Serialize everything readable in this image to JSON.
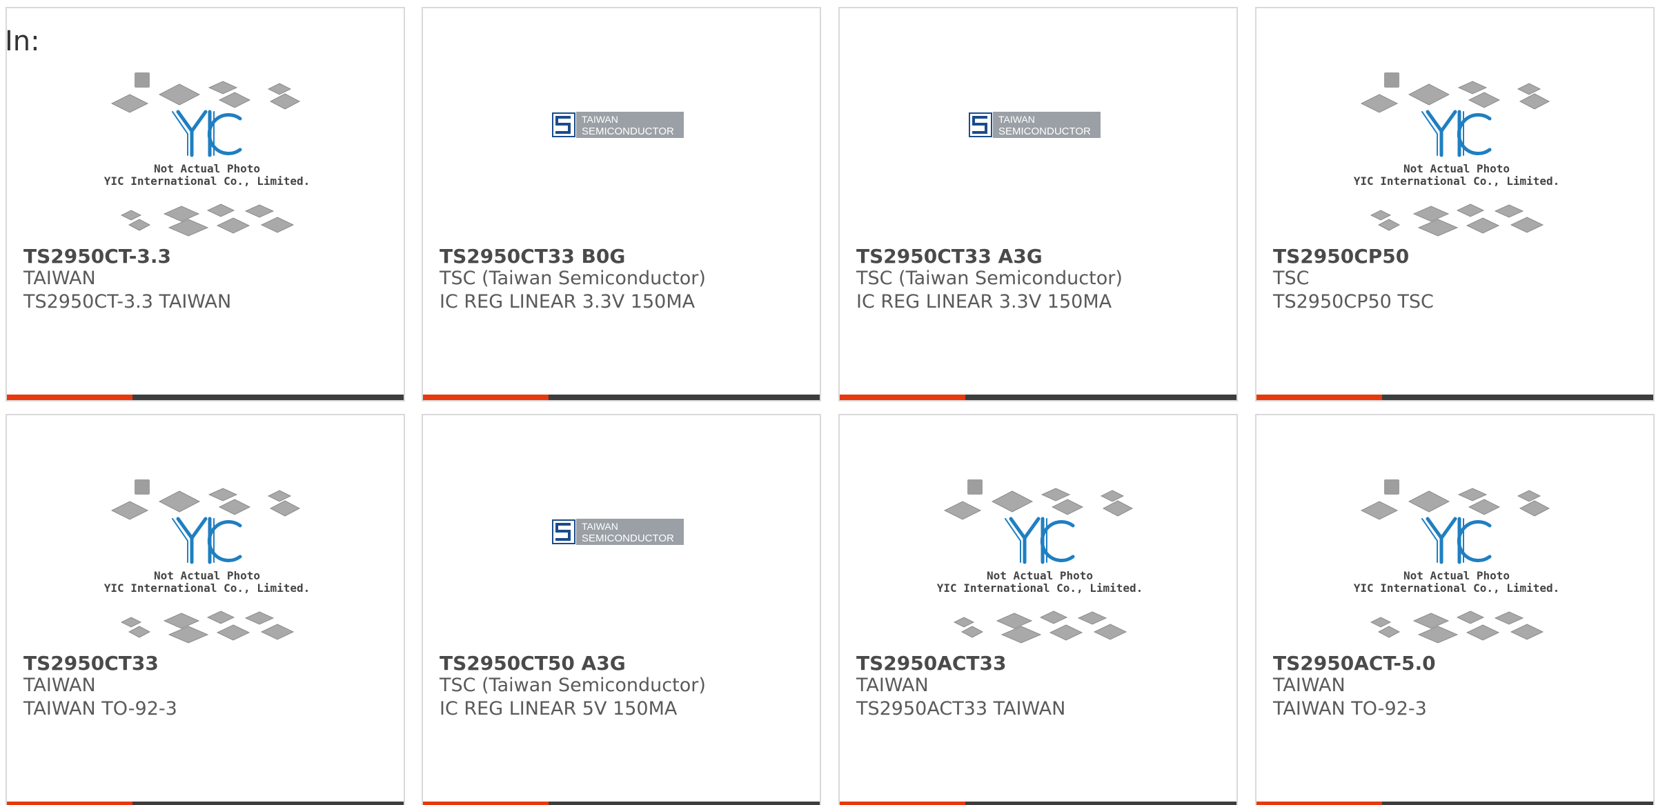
{
  "header": {
    "prefix": "In:"
  },
  "brand_colors": {
    "accent": "#e8380d",
    "bar": "#3d3d3d",
    "yic_blue": "#1f7fc1",
    "tsc_blue": "#1a4c8c",
    "tsc_gray": "#9aa0a6"
  },
  "cards": [
    {
      "part": "TS2950CT-3.3",
      "maker": "TAIWAN",
      "desc": "TS2950CT-3.3 TAIWAN",
      "image": "yic-placeholder",
      "yic_line1": "Not Actual Photo",
      "yic_line2": "YIC International Co., Limited."
    },
    {
      "part": "TS2950CT33 B0G",
      "maker": "TSC (Taiwan Semiconductor)",
      "desc": "IC REG LINEAR 3.3V 150MA",
      "image": "tsc-logo",
      "logo_line1": "TAIWAN",
      "logo_line2": "SEMICONDUCTOR"
    },
    {
      "part": "TS2950CT33 A3G",
      "maker": "TSC (Taiwan Semiconductor)",
      "desc": "IC REG LINEAR 3.3V 150MA",
      "image": "tsc-logo",
      "logo_line1": "TAIWAN",
      "logo_line2": "SEMICONDUCTOR"
    },
    {
      "part": "TS2950CP50",
      "maker": "TSC",
      "desc": "TS2950CP50 TSC",
      "image": "yic-placeholder",
      "yic_line1": "Not Actual Photo",
      "yic_line2": "YIC International Co., Limited."
    },
    {
      "part": "TS2950CT33",
      "maker": "TAIWAN",
      "desc": "TAIWAN TO-92-3",
      "image": "yic-placeholder",
      "yic_line1": "Not Actual Photo",
      "yic_line2": "YIC International Co., Limited."
    },
    {
      "part": "TS2950CT50 A3G",
      "maker": "TSC (Taiwan Semiconductor)",
      "desc": "IC REG LINEAR 5V 150MA",
      "image": "tsc-logo",
      "logo_line1": "TAIWAN",
      "logo_line2": "SEMICONDUCTOR"
    },
    {
      "part": "TS2950ACT33",
      "maker": "TAIWAN",
      "desc": "TS2950ACT33 TAIWAN",
      "image": "yic-placeholder",
      "yic_line1": "Not Actual Photo",
      "yic_line2": "YIC International Co., Limited."
    },
    {
      "part": "TS2950ACT-5.0",
      "maker": "TAIWAN",
      "desc": "TAIWAN TO-92-3",
      "image": "yic-placeholder",
      "yic_line1": "Not Actual Photo",
      "yic_line2": "YIC International Co., Limited."
    }
  ]
}
